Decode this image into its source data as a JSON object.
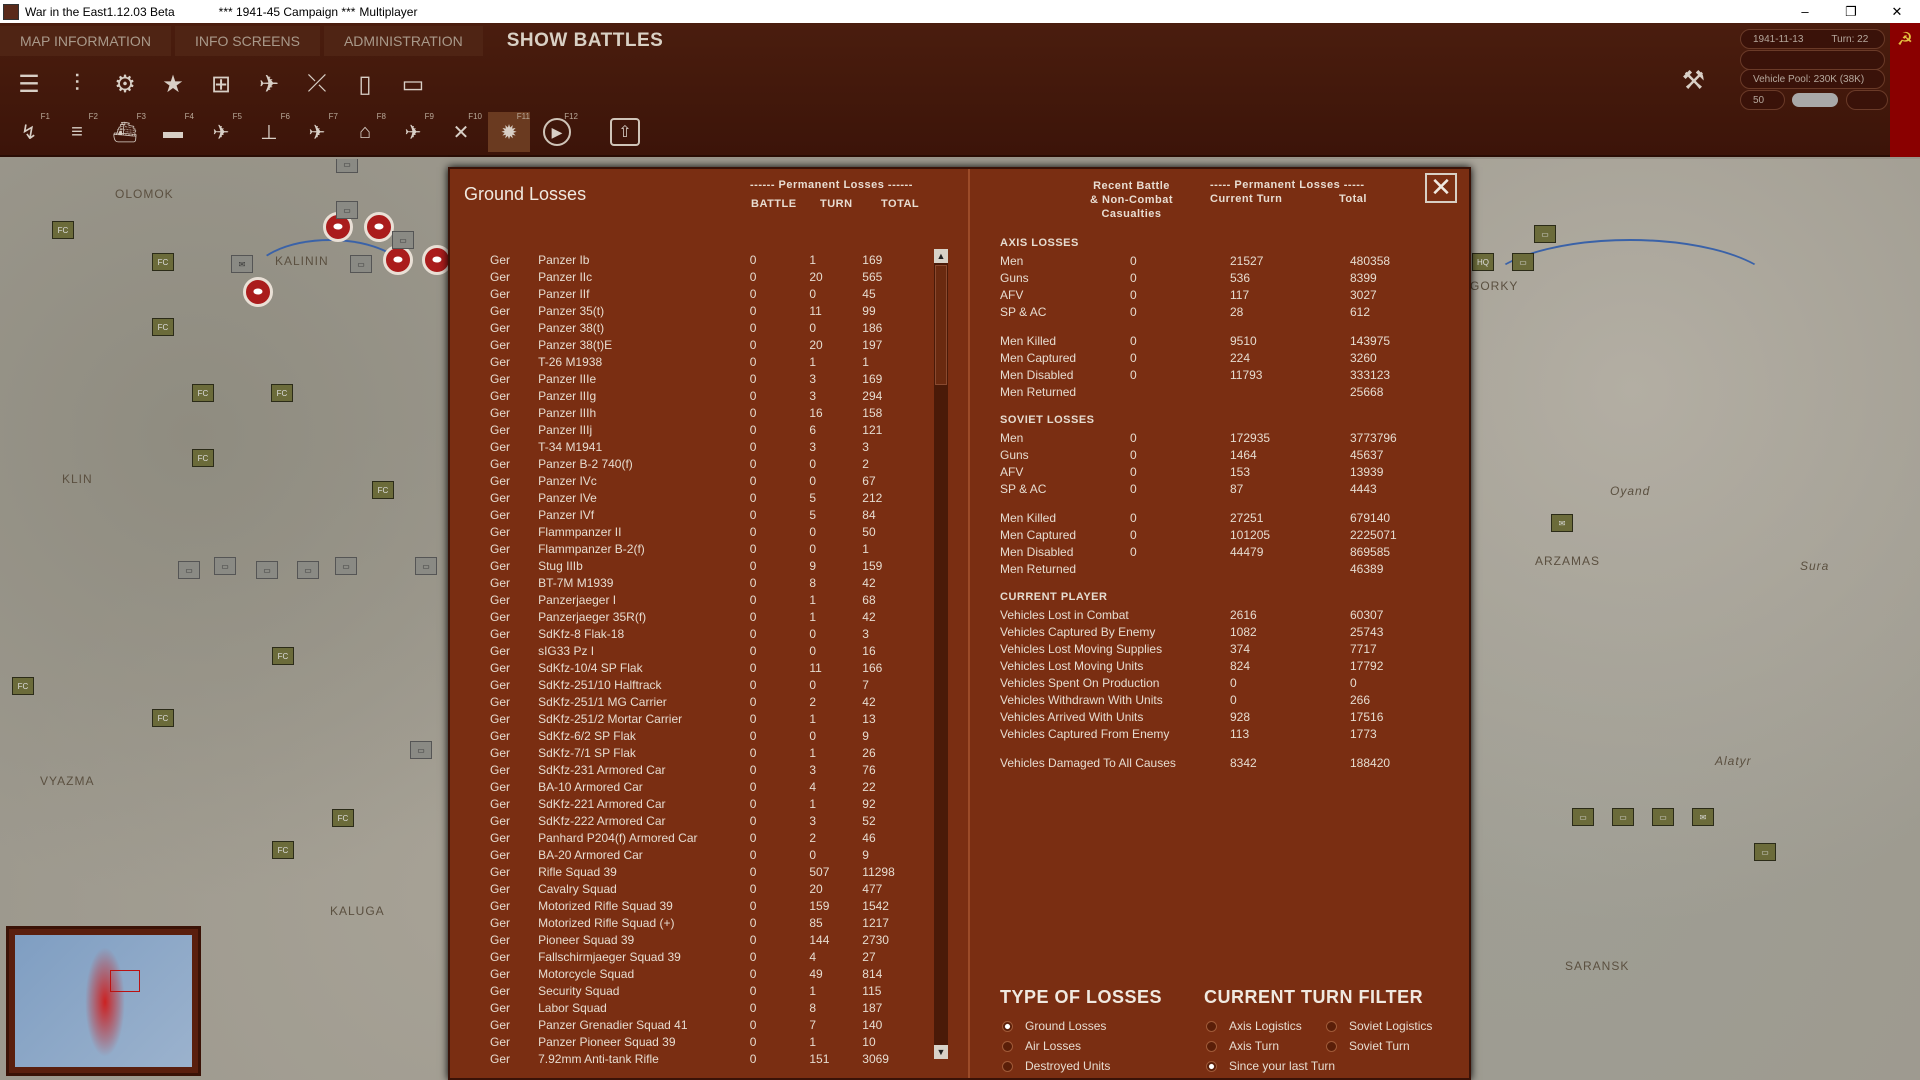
{
  "window": {
    "title": "War in the East1.12.03 Beta",
    "campaign": "*** 1941-45 Campaign ***",
    "mode": "Multiplayer",
    "controls": [
      "–",
      "❐",
      "✕"
    ]
  },
  "menu": {
    "items": [
      "MAP INFORMATION",
      "INFO SCREENS",
      "ADMINISTRATION"
    ],
    "show_battles": "SHOW BATTLES"
  },
  "toolbar": {
    "row1_icons": [
      "menu-icon",
      "sliders-icon",
      "gear-icon",
      "star-icon",
      "hq-icon",
      "air-icon",
      "rail-icon",
      "fuel-icon",
      "supply-icon"
    ],
    "row2_keys": [
      "F1",
      "F2",
      "F3",
      "F4",
      "F5",
      "F6",
      "F7",
      "F8",
      "F9",
      "F10",
      "F11",
      "F12"
    ]
  },
  "status": {
    "date": "1941-11-13",
    "turn": "Turn: 22",
    "vehicle_pool": "Vehicle Pool: 230K (38K)",
    "value": "50"
  },
  "map": {
    "labels": [
      "OLOMOK",
      "KALININ",
      "KLIN",
      "VYAZMA",
      "KALUGA",
      "GORKY",
      "ARZAMAS",
      "SARANSK",
      "Alatyr",
      "Oyand",
      "Sura"
    ]
  },
  "dialog": {
    "title": "Ground Losses",
    "headers": {
      "perm_losses": "------ Permanent Losses ------",
      "battle": "BATTLE",
      "turn": "TURN",
      "total": "TOTAL",
      "recent_battle": "Recent Battle\n& Non-Combat\nCasualties",
      "perm_losses2": "----- Permanent Losses -----",
      "current_turn": "Current Turn",
      "total2": "Total"
    },
    "close": "✕",
    "rows": [
      [
        "Ger",
        "Panzer Ib",
        "0",
        "1",
        "169"
      ],
      [
        "Ger",
        "Panzer IIc",
        "0",
        "20",
        "565"
      ],
      [
        "Ger",
        "Panzer IIf",
        "0",
        "0",
        "45"
      ],
      [
        "Ger",
        "Panzer 35(t)",
        "0",
        "11",
        "99"
      ],
      [
        "Ger",
        "Panzer 38(t)",
        "0",
        "0",
        "186"
      ],
      [
        "Ger",
        "Panzer 38(t)E",
        "0",
        "20",
        "197"
      ],
      [
        "Ger",
        "T-26 M1938",
        "0",
        "1",
        "1"
      ],
      [
        "Ger",
        "Panzer IIIe",
        "0",
        "3",
        "169"
      ],
      [
        "Ger",
        "Panzer IIIg",
        "0",
        "3",
        "294"
      ],
      [
        "Ger",
        "Panzer IIIh",
        "0",
        "16",
        "158"
      ],
      [
        "Ger",
        "Panzer IIIj",
        "0",
        "6",
        "121"
      ],
      [
        "Ger",
        "T-34 M1941",
        "0",
        "3",
        "3"
      ],
      [
        "Ger",
        "Panzer B-2 740(f)",
        "0",
        "0",
        "2"
      ],
      [
        "Ger",
        "Panzer IVc",
        "0",
        "0",
        "67"
      ],
      [
        "Ger",
        "Panzer IVe",
        "0",
        "5",
        "212"
      ],
      [
        "Ger",
        "Panzer IVf",
        "0",
        "5",
        "84"
      ],
      [
        "Ger",
        "Flammpanzer II",
        "0",
        "0",
        "50"
      ],
      [
        "Ger",
        "Flammpanzer B-2(f)",
        "0",
        "0",
        "1"
      ],
      [
        "Ger",
        "Stug IIIb",
        "0",
        "9",
        "159"
      ],
      [
        "Ger",
        "BT-7M M1939",
        "0",
        "8",
        "42"
      ],
      [
        "Ger",
        "Panzerjaeger I",
        "0",
        "1",
        "68"
      ],
      [
        "Ger",
        "Panzerjaeger 35R(f)",
        "0",
        "1",
        "42"
      ],
      [
        "Ger",
        "SdKfz-8 Flak-18",
        "0",
        "0",
        "3"
      ],
      [
        "Ger",
        "sIG33 Pz I",
        "0",
        "0",
        "16"
      ],
      [
        "Ger",
        "SdKfz-10/4 SP Flak",
        "0",
        "11",
        "166"
      ],
      [
        "Ger",
        "SdKfz-251/10 Halftrack",
        "0",
        "0",
        "7"
      ],
      [
        "Ger",
        "SdKfz-251/1 MG Carrier",
        "0",
        "2",
        "42"
      ],
      [
        "Ger",
        "SdKfz-251/2 Mortar Carrier",
        "0",
        "1",
        "13"
      ],
      [
        "Ger",
        "SdKfz-6/2 SP Flak",
        "0",
        "0",
        "9"
      ],
      [
        "Ger",
        "SdKfz-7/1 SP Flak",
        "0",
        "1",
        "26"
      ],
      [
        "Ger",
        "SdKfz-231 Armored Car",
        "0",
        "3",
        "76"
      ],
      [
        "Ger",
        "BA-10 Armored Car",
        "0",
        "4",
        "22"
      ],
      [
        "Ger",
        "SdKfz-221 Armored Car",
        "0",
        "1",
        "92"
      ],
      [
        "Ger",
        "SdKfz-222 Armored Car",
        "0",
        "3",
        "52"
      ],
      [
        "Ger",
        "Panhard P204(f) Armored Car",
        "0",
        "2",
        "46"
      ],
      [
        "Ger",
        "BA-20 Armored Car",
        "0",
        "0",
        "9"
      ],
      [
        "Ger",
        "Rifle Squad 39",
        "0",
        "507",
        "11298"
      ],
      [
        "Ger",
        "Cavalry Squad",
        "0",
        "20",
        "477"
      ],
      [
        "Ger",
        "Motorized Rifle Squad 39",
        "0",
        "159",
        "1542"
      ],
      [
        "Ger",
        "Motorized Rifle Squad (+)",
        "0",
        "85",
        "1217"
      ],
      [
        "Ger",
        "Pioneer Squad 39",
        "0",
        "144",
        "2730"
      ],
      [
        "Ger",
        "Fallschirmjaeger Squad 39",
        "0",
        "4",
        "27"
      ],
      [
        "Ger",
        "Motorcycle Squad",
        "0",
        "49",
        "814"
      ],
      [
        "Ger",
        "Security Squad",
        "0",
        "1",
        "115"
      ],
      [
        "Ger",
        "Labor Squad",
        "0",
        "8",
        "187"
      ],
      [
        "Ger",
        "Panzer Grenadier Squad 41",
        "0",
        "7",
        "140"
      ],
      [
        "Ger",
        "Panzer Pioneer Squad 39",
        "0",
        "1",
        "10"
      ],
      [
        "Ger",
        "7.92mm Anti-tank Rifle",
        "0",
        "151",
        "3069"
      ]
    ],
    "axis": {
      "title": "AXIS LOSSES",
      "rows": [
        [
          "Men",
          "0",
          "21527",
          "480358"
        ],
        [
          "Guns",
          "0",
          "536",
          "8399"
        ],
        [
          "AFV",
          "0",
          "117",
          "3027"
        ],
        [
          "SP & AC",
          "0",
          "28",
          "612"
        ],
        [
          "Men Killed",
          "0",
          "9510",
          "143975"
        ],
        [
          "Men Captured",
          "0",
          "224",
          "3260"
        ],
        [
          "Men Disabled",
          "0",
          "11793",
          "333123"
        ],
        [
          "Men Returned",
          "",
          "",
          "25668"
        ]
      ]
    },
    "soviet": {
      "title": "SOVIET LOSSES",
      "rows": [
        [
          "Men",
          "0",
          "172935",
          "3773796"
        ],
        [
          "Guns",
          "0",
          "1464",
          "45637"
        ],
        [
          "AFV",
          "0",
          "153",
          "13939"
        ],
        [
          "SP & AC",
          "0",
          "87",
          "4443"
        ],
        [
          "Men Killed",
          "0",
          "27251",
          "679140"
        ],
        [
          "Men Captured",
          "0",
          "101205",
          "2225071"
        ],
        [
          "Men Disabled",
          "0",
          "44479",
          "869585"
        ],
        [
          "Men Returned",
          "",
          "",
          "46389"
        ]
      ]
    },
    "player": {
      "title": "CURRENT PLAYER",
      "rows": [
        [
          "Vehicles Lost in Combat",
          "2616",
          "60307"
        ],
        [
          "Vehicles Captured By Enemy",
          "1082",
          "25743"
        ],
        [
          "Vehicles Lost Moving Supplies",
          "374",
          "7717"
        ],
        [
          "Vehicles Lost Moving Units",
          "824",
          "17792"
        ],
        [
          "Vehicles Spent On Production",
          "0",
          "0"
        ],
        [
          "Vehicles Withdrawn With Units",
          "0",
          "266"
        ],
        [
          "Vehicles Arrived With Units",
          "928",
          "17516"
        ],
        [
          "Vehicles Captured From Enemy",
          "113",
          "1773"
        ],
        [
          "Vehicles Damaged To All Causes",
          "8342",
          "188420"
        ]
      ]
    },
    "type_of_losses": {
      "title": "TYPE OF LOSSES",
      "options": [
        "Ground Losses",
        "Air Losses",
        "Destroyed Units"
      ]
    },
    "turn_filter": {
      "title": "CURRENT TURN FILTER",
      "options": [
        "Axis Logistics",
        "Soviet Logistics",
        "Axis Turn",
        "Soviet Turn",
        "Since your last Turn"
      ]
    }
  }
}
